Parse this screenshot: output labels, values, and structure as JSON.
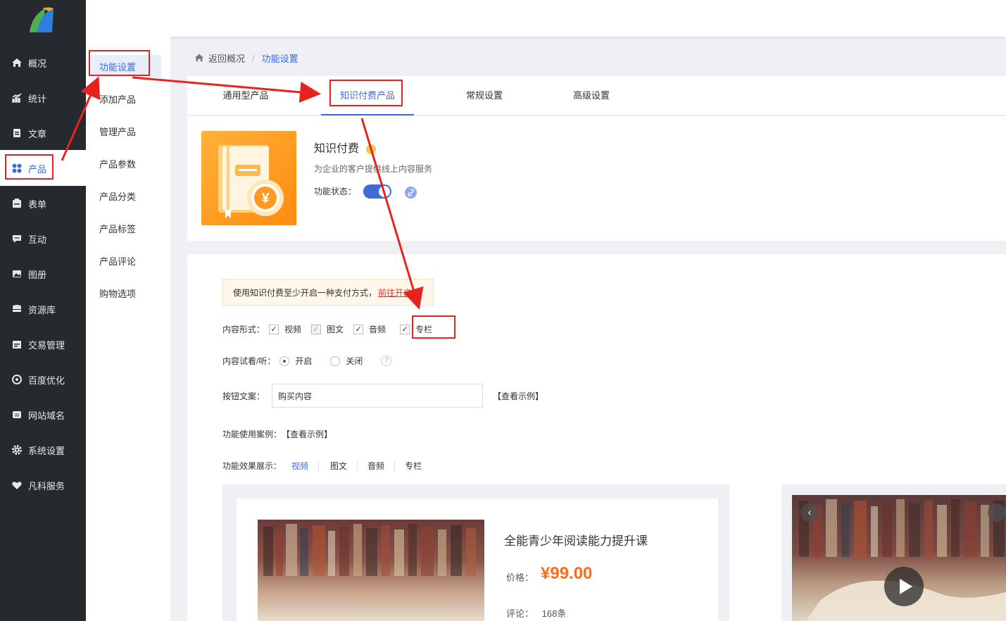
{
  "nav": {
    "items": [
      {
        "label": "概况",
        "icon": "home-icon"
      },
      {
        "label": "统计",
        "icon": "chart-icon"
      },
      {
        "label": "文章",
        "icon": "article-icon"
      },
      {
        "label": "产品",
        "icon": "grid-icon"
      },
      {
        "label": "表单",
        "icon": "form-icon"
      },
      {
        "label": "互动",
        "icon": "chat-icon"
      },
      {
        "label": "图册",
        "icon": "image-icon"
      },
      {
        "label": "资源库",
        "icon": "database-icon"
      },
      {
        "label": "交易管理",
        "icon": "trade-icon"
      },
      {
        "label": "百度优化",
        "icon": "seo-icon"
      },
      {
        "label": "网站域名",
        "icon": "domain-icon"
      },
      {
        "label": "系统设置",
        "icon": "gear-icon"
      },
      {
        "label": "凡科服务",
        "icon": "heart-icon"
      }
    ]
  },
  "subnav": {
    "items": [
      "功能设置",
      "添加产品",
      "管理产品",
      "产品参数",
      "产品分类",
      "产品标签",
      "产品评论",
      "购物选项"
    ]
  },
  "breadcrumb": {
    "back": "返回概况",
    "separator": "/",
    "current": "功能设置"
  },
  "tabs": [
    "通用型产品",
    "知识付费产品",
    "常规设置",
    "高级设置"
  ],
  "feature": {
    "title": "知识付费",
    "badge": "vip-crown-icon",
    "desc": "为企业的客户提供线上内容服务",
    "state_label": "功能状态：",
    "currency": "¥"
  },
  "settings": {
    "notice_text": "使用知识付费至少开启一种支付方式，",
    "notice_link": "前往开启",
    "content_form_label": "内容形式：",
    "content_forms": [
      "视频",
      "图文",
      "音频",
      "专栏"
    ],
    "trial_label": "内容试看/听：",
    "trial_on": "开启",
    "trial_off": "关闭",
    "trial_help": "?",
    "button_text_label": "按钮文案：",
    "button_text_value": "购买内容",
    "view_example": "【查看示例】",
    "case_label": "功能使用案例：",
    "case_link": "【查看示例】",
    "effect_label": "功能效果展示：",
    "effect_tabs": [
      "视频",
      "图文",
      "音频",
      "专栏"
    ]
  },
  "preview": {
    "title": "全能青少年阅读能力提升课",
    "price_label": "价格：",
    "price": "¥99.00",
    "comment_label": "评论：",
    "comment_value": "168条"
  },
  "colors": {
    "accent": "#3f6ad8",
    "nav_bg": "#26292e",
    "price": "#ff6b1a",
    "annotation": "#e8231d"
  }
}
